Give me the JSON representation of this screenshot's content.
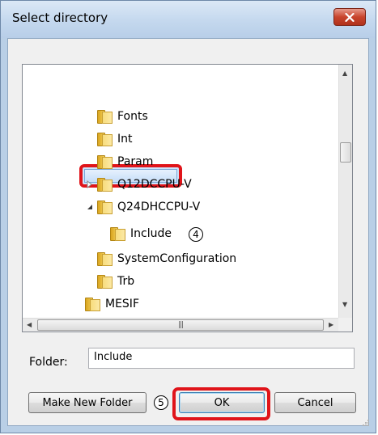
{
  "window": {
    "title": "Select directory",
    "close_icon": "close-x-icon"
  },
  "tree": {
    "items": [
      {
        "label": "Fonts",
        "indent": 2,
        "expander": "none"
      },
      {
        "label": "Int",
        "indent": 2,
        "expander": "none"
      },
      {
        "label": "Param",
        "indent": 2,
        "expander": "none"
      },
      {
        "label": "Q12DCCPU-V",
        "indent": 2,
        "expander": "collapsed"
      },
      {
        "label": "Q24DHCCPU-V",
        "indent": 2,
        "expander": "expanded"
      },
      {
        "label": "Include",
        "indent": 3,
        "expander": "none",
        "selected": true
      },
      {
        "label": "SystemConfiguration",
        "indent": 3,
        "expander": "none"
      },
      {
        "label": "Trb",
        "indent": 3,
        "expander": "none"
      },
      {
        "label": "MESIF",
        "indent": 1,
        "expander": "none"
      }
    ]
  },
  "annotations": {
    "step_include": "4",
    "step_ok": "5"
  },
  "folder_field": {
    "label": "Folder:",
    "value": "Include"
  },
  "buttons": {
    "make_new_folder": "Make New Folder",
    "ok": "OK",
    "cancel": "Cancel"
  },
  "colors": {
    "highlight": "#e0141a",
    "title_bar": "#c4d8ee",
    "close_button": "#c8442c"
  }
}
